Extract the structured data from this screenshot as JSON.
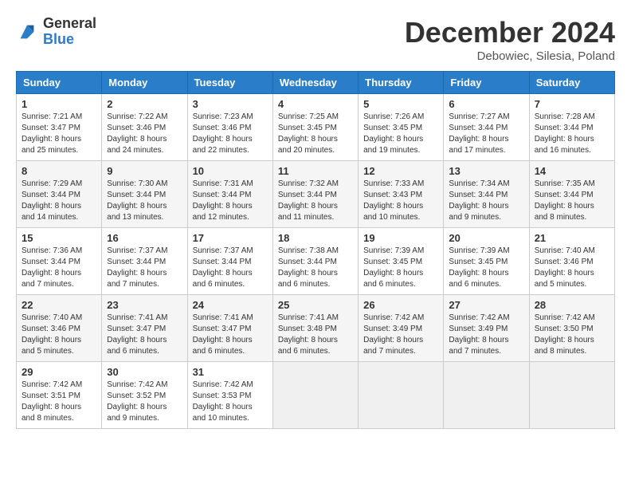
{
  "header": {
    "logo_general": "General",
    "logo_blue": "Blue",
    "title": "December 2024",
    "location": "Debowiec, Silesia, Poland"
  },
  "calendar": {
    "days_of_week": [
      "Sunday",
      "Monday",
      "Tuesday",
      "Wednesday",
      "Thursday",
      "Friday",
      "Saturday"
    ],
    "weeks": [
      [
        {
          "day": "1",
          "sunrise": "7:21 AM",
          "sunset": "3:47 PM",
          "daylight": "8 hours and 25 minutes."
        },
        {
          "day": "2",
          "sunrise": "7:22 AM",
          "sunset": "3:46 PM",
          "daylight": "8 hours and 24 minutes."
        },
        {
          "day": "3",
          "sunrise": "7:23 AM",
          "sunset": "3:46 PM",
          "daylight": "8 hours and 22 minutes."
        },
        {
          "day": "4",
          "sunrise": "7:25 AM",
          "sunset": "3:45 PM",
          "daylight": "8 hours and 20 minutes."
        },
        {
          "day": "5",
          "sunrise": "7:26 AM",
          "sunset": "3:45 PM",
          "daylight": "8 hours and 19 minutes."
        },
        {
          "day": "6",
          "sunrise": "7:27 AM",
          "sunset": "3:44 PM",
          "daylight": "8 hours and 17 minutes."
        },
        {
          "day": "7",
          "sunrise": "7:28 AM",
          "sunset": "3:44 PM",
          "daylight": "8 hours and 16 minutes."
        }
      ],
      [
        {
          "day": "8",
          "sunrise": "7:29 AM",
          "sunset": "3:44 PM",
          "daylight": "8 hours and 14 minutes."
        },
        {
          "day": "9",
          "sunrise": "7:30 AM",
          "sunset": "3:44 PM",
          "daylight": "8 hours and 13 minutes."
        },
        {
          "day": "10",
          "sunrise": "7:31 AM",
          "sunset": "3:44 PM",
          "daylight": "8 hours and 12 minutes."
        },
        {
          "day": "11",
          "sunrise": "7:32 AM",
          "sunset": "3:44 PM",
          "daylight": "8 hours and 11 minutes."
        },
        {
          "day": "12",
          "sunrise": "7:33 AM",
          "sunset": "3:43 PM",
          "daylight": "8 hours and 10 minutes."
        },
        {
          "day": "13",
          "sunrise": "7:34 AM",
          "sunset": "3:44 PM",
          "daylight": "8 hours and 9 minutes."
        },
        {
          "day": "14",
          "sunrise": "7:35 AM",
          "sunset": "3:44 PM",
          "daylight": "8 hours and 8 minutes."
        }
      ],
      [
        {
          "day": "15",
          "sunrise": "7:36 AM",
          "sunset": "3:44 PM",
          "daylight": "8 hours and 7 minutes."
        },
        {
          "day": "16",
          "sunrise": "7:37 AM",
          "sunset": "3:44 PM",
          "daylight": "8 hours and 7 minutes."
        },
        {
          "day": "17",
          "sunrise": "7:37 AM",
          "sunset": "3:44 PM",
          "daylight": "8 hours and 6 minutes."
        },
        {
          "day": "18",
          "sunrise": "7:38 AM",
          "sunset": "3:44 PM",
          "daylight": "8 hours and 6 minutes."
        },
        {
          "day": "19",
          "sunrise": "7:39 AM",
          "sunset": "3:45 PM",
          "daylight": "8 hours and 6 minutes."
        },
        {
          "day": "20",
          "sunrise": "7:39 AM",
          "sunset": "3:45 PM",
          "daylight": "8 hours and 6 minutes."
        },
        {
          "day": "21",
          "sunrise": "7:40 AM",
          "sunset": "3:46 PM",
          "daylight": "8 hours and 5 minutes."
        }
      ],
      [
        {
          "day": "22",
          "sunrise": "7:40 AM",
          "sunset": "3:46 PM",
          "daylight": "8 hours and 5 minutes."
        },
        {
          "day": "23",
          "sunrise": "7:41 AM",
          "sunset": "3:47 PM",
          "daylight": "8 hours and 6 minutes."
        },
        {
          "day": "24",
          "sunrise": "7:41 AM",
          "sunset": "3:47 PM",
          "daylight": "8 hours and 6 minutes."
        },
        {
          "day": "25",
          "sunrise": "7:41 AM",
          "sunset": "3:48 PM",
          "daylight": "8 hours and 6 minutes."
        },
        {
          "day": "26",
          "sunrise": "7:42 AM",
          "sunset": "3:49 PM",
          "daylight": "8 hours and 7 minutes."
        },
        {
          "day": "27",
          "sunrise": "7:42 AM",
          "sunset": "3:49 PM",
          "daylight": "8 hours and 7 minutes."
        },
        {
          "day": "28",
          "sunrise": "7:42 AM",
          "sunset": "3:50 PM",
          "daylight": "8 hours and 8 minutes."
        }
      ],
      [
        {
          "day": "29",
          "sunrise": "7:42 AM",
          "sunset": "3:51 PM",
          "daylight": "8 hours and 8 minutes."
        },
        {
          "day": "30",
          "sunrise": "7:42 AM",
          "sunset": "3:52 PM",
          "daylight": "8 hours and 9 minutes."
        },
        {
          "day": "31",
          "sunrise": "7:42 AM",
          "sunset": "3:53 PM",
          "daylight": "8 hours and 10 minutes."
        },
        null,
        null,
        null,
        null
      ]
    ]
  }
}
